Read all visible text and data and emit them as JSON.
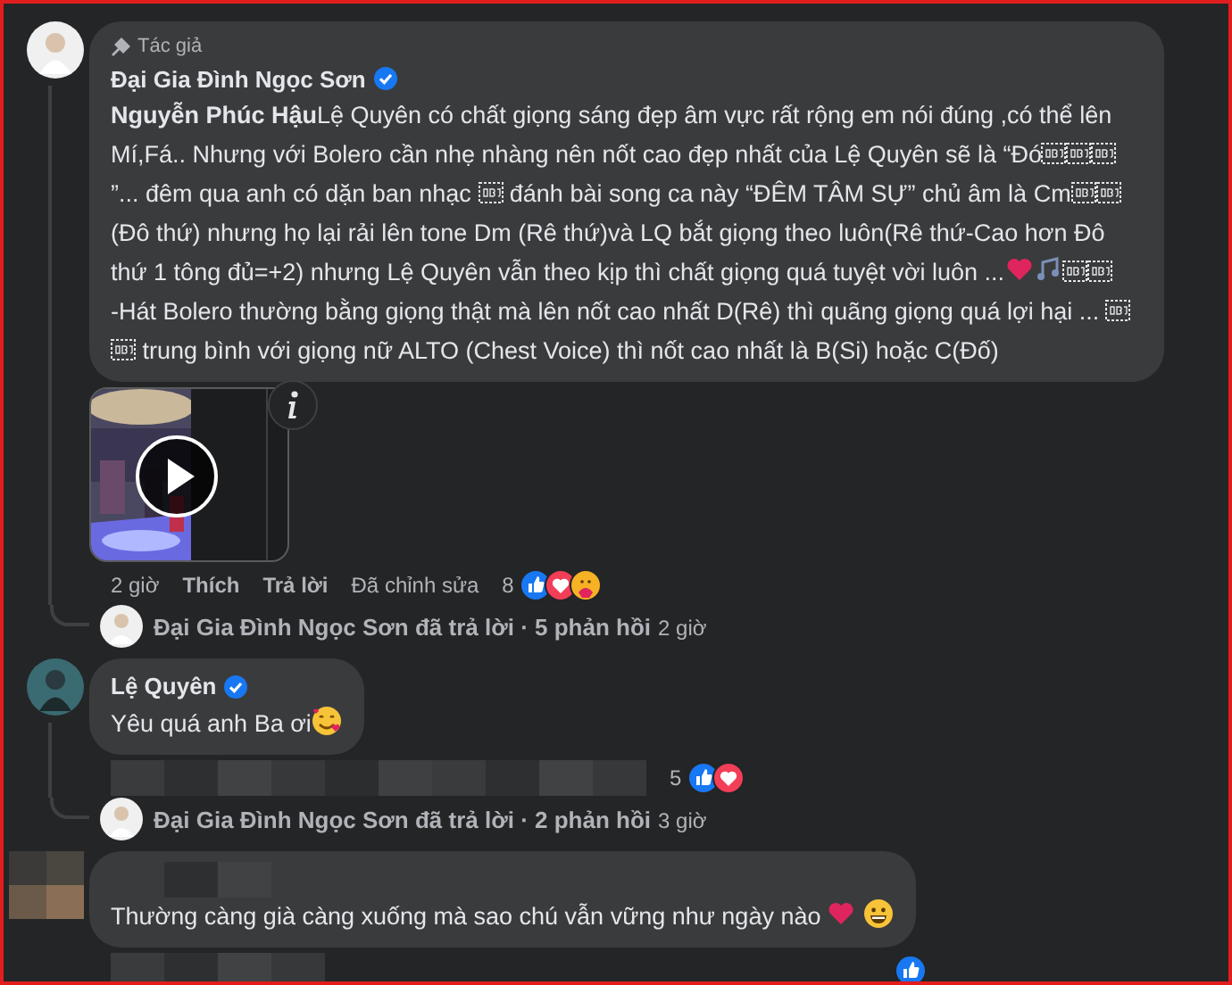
{
  "comments": [
    {
      "badge": "Tác giả",
      "author": "Đại Gia Đình Ngọc Sơn",
      "verified": true,
      "blurred": false,
      "paragraphs": [
        [
          {
            "kind": "text",
            "text": "**Nguyễn Phúc Hậu**Lệ Quyên có chất giọng sáng đẹp âm vực rất rộng em nói đúng ,có thể lên Mí,Fá.. Nhưng với Bolero cần nhẹ nhàng nên nốt cao đẹp nhất của Lệ Quyên sẽ là “Đó"
          },
          {
            "kind": "obj"
          },
          {
            "kind": "obj"
          },
          {
            "kind": "obj"
          },
          {
            "kind": "text",
            "text": "”... đêm qua anh có dặn ban nhạc "
          },
          {
            "kind": "obj"
          },
          {
            "kind": "text",
            "text": " đánh bài song ca này “ĐÊM TÂM SỰ” chủ âm là Cm"
          },
          {
            "kind": "obj"
          },
          {
            "kind": "obj"
          },
          {
            "kind": "text",
            "text": "(Đô thứ) nhưng họ lại rải lên tone Dm (Rê thứ)và LQ bắt giọng theo luôn(Rê thứ-Cao hơn Đô thứ 1 tông đủ=+2) nhưng Lệ Quyên vẫn theo kịp thì chất giọng quá tuyệt vời luôn ..."
          },
          {
            "kind": "heart"
          },
          {
            "kind": "notes"
          },
          {
            "kind": "obj"
          },
          {
            "kind": "obj"
          }
        ],
        [
          {
            "kind": "text",
            "text": "-Hát Bolero thường bằng giọng thật mà lên nốt cao nhất D(Rê) thì quãng giọng quá lợi hại ... "
          },
          {
            "kind": "obj"
          },
          {
            "kind": "obj"
          },
          {
            "kind": "text",
            "text": " trung bình với giọng nữ ALTO (Chest Voice) thì nốt cao nhất là B(Si) hoặc C(Đố)"
          }
        ]
      ],
      "video": true,
      "actions": [
        {
          "kind": "time",
          "text": "2 giờ"
        },
        {
          "kind": "button",
          "text": "Thích"
        },
        {
          "kind": "button",
          "text": "Trả lời"
        },
        {
          "kind": "note",
          "text": "Đã chỉnh sửa"
        }
      ],
      "actions_blurred": false,
      "reaction_count": "8",
      "reactions": [
        {
          "kind": "like"
        },
        {
          "kind": "love"
        },
        {
          "kind": "care"
        }
      ],
      "replies": {
        "text": "Đại Gia Đình Ngọc Sơn đã trả lời · 5 phản hồi",
        "time": "2 giờ"
      }
    },
    {
      "author": "Lệ Quyên",
      "verified": true,
      "blurred": false,
      "paragraphs": [
        [
          {
            "kind": "text",
            "text": "Yêu quá anh Ba ơi"
          },
          {
            "kind": "hearts-face"
          }
        ]
      ],
      "video": false,
      "actions_blurred": true,
      "reaction_count": "5",
      "reactions": [
        {
          "kind": "like"
        },
        {
          "kind": "love"
        }
      ],
      "replies": {
        "text": "Đại Gia Đình Ngọc Sơn đã trả lời · 2 phản hồi",
        "time": "3 giờ"
      }
    },
    {
      "verified": false,
      "blurred": true,
      "paragraphs": [
        [
          {
            "kind": "text",
            "text": "Thường càng già càng xuống mà sao chú vẫn vững như ngày nào "
          },
          {
            "kind": "heart"
          },
          {
            "kind": "grin"
          }
        ]
      ],
      "video": false,
      "actions_blurred": true,
      "reactions": [
        {
          "kind": "like"
        }
      ]
    }
  ]
}
